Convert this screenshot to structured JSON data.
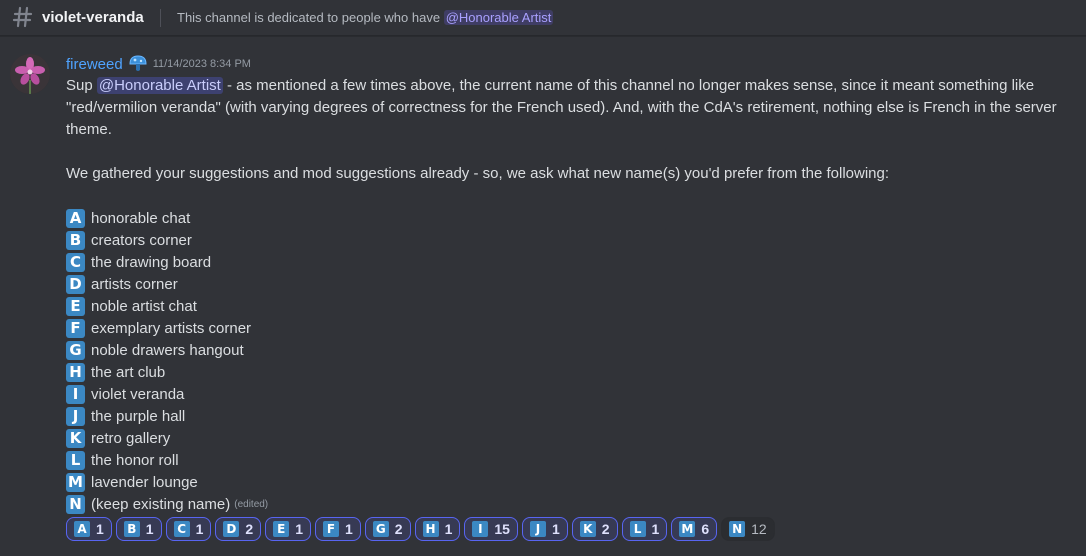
{
  "header": {
    "channel_name": "violet-veranda",
    "topic_prefix": "This channel is dedicated to people who have",
    "topic_mention": "@Honorable Artist",
    "icon": "hashtag-icon"
  },
  "message": {
    "username": "fireweed",
    "timestamp": "11/14/2023 8:34 PM",
    "username_color": "#4fa3ff",
    "greeting": "Sup",
    "mention": "@Honorable Artist",
    "paragraph1_rest": " - as mentioned a few times above, the current name of this channel no longer makes sense, since it meant something like \"red/vermilion veranda\" (with varying degrees of correctness for the French used). And, with the CdA's retirement, nothing else is French in the server theme.",
    "paragraph2": "We gathered your suggestions and mod suggestions already - so, we ask what new name(s) you'd prefer from the following:",
    "options": [
      {
        "letter": "A",
        "text": "honorable chat"
      },
      {
        "letter": "B",
        "text": "creators corner"
      },
      {
        "letter": "C",
        "text": "the drawing board"
      },
      {
        "letter": "D",
        "text": "artists corner"
      },
      {
        "letter": "E",
        "text": "noble artist chat"
      },
      {
        "letter": "F",
        "text": "exemplary artists corner"
      },
      {
        "letter": "G",
        "text": "noble drawers hangout"
      },
      {
        "letter": "H",
        "text": "the art club"
      },
      {
        "letter": "I",
        "text": "violet veranda"
      },
      {
        "letter": "J",
        "text": "the purple hall"
      },
      {
        "letter": "K",
        "text": "retro gallery"
      },
      {
        "letter": "L",
        "text": "the honor roll"
      },
      {
        "letter": "M",
        "text": "lavender lounge"
      },
      {
        "letter": "N",
        "text": "(keep existing name)"
      }
    ],
    "edited_label": "(edited)"
  },
  "reactions": [
    {
      "letter": "A",
      "count": "1",
      "active": true
    },
    {
      "letter": "B",
      "count": "1",
      "active": true
    },
    {
      "letter": "C",
      "count": "1",
      "active": true
    },
    {
      "letter": "D",
      "count": "2",
      "active": true
    },
    {
      "letter": "E",
      "count": "1",
      "active": true
    },
    {
      "letter": "F",
      "count": "1",
      "active": true
    },
    {
      "letter": "G",
      "count": "2",
      "active": true
    },
    {
      "letter": "H",
      "count": "1",
      "active": true
    },
    {
      "letter": "I",
      "count": "15",
      "active": true
    },
    {
      "letter": "J",
      "count": "1",
      "active": true
    },
    {
      "letter": "K",
      "count": "2",
      "active": true
    },
    {
      "letter": "L",
      "count": "1",
      "active": true
    },
    {
      "letter": "M",
      "count": "6",
      "active": true
    },
    {
      "letter": "N",
      "count": "12",
      "active": false
    }
  ],
  "colors": {
    "background": "#313338",
    "regional_indicator": "#3b88c3",
    "mention_bg": "#5865f2",
    "reaction_active_border": "#5865f2"
  }
}
